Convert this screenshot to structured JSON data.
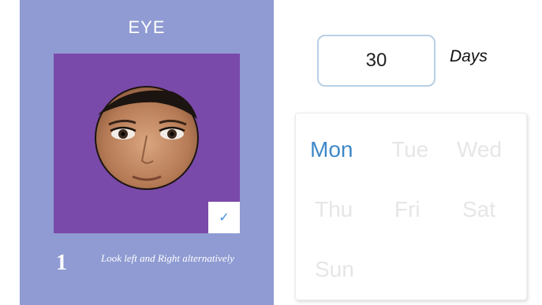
{
  "exercise_card": {
    "title": "EYE",
    "step_number": "1",
    "instruction": "Look left and Right alternatively",
    "completed": true,
    "check_icon": "checkmark-icon",
    "colors": {
      "card_bg": "#8f9bd2",
      "preview_bg": "#7a4aaa",
      "check": "#3f8fdc"
    }
  },
  "duration": {
    "value": "30",
    "unit_label": "Days"
  },
  "weekdays": {
    "items": [
      {
        "label": "Mon",
        "selected": true
      },
      {
        "label": "Tue",
        "selected": false
      },
      {
        "label": "Wed",
        "selected": false
      },
      {
        "label": "Thu",
        "selected": false
      },
      {
        "label": "Fri",
        "selected": false
      },
      {
        "label": "Sat",
        "selected": false
      },
      {
        "label": "Sun",
        "selected": false
      }
    ],
    "colors": {
      "selected": "#3f88c8",
      "unselected": "#e6e6e6"
    }
  }
}
